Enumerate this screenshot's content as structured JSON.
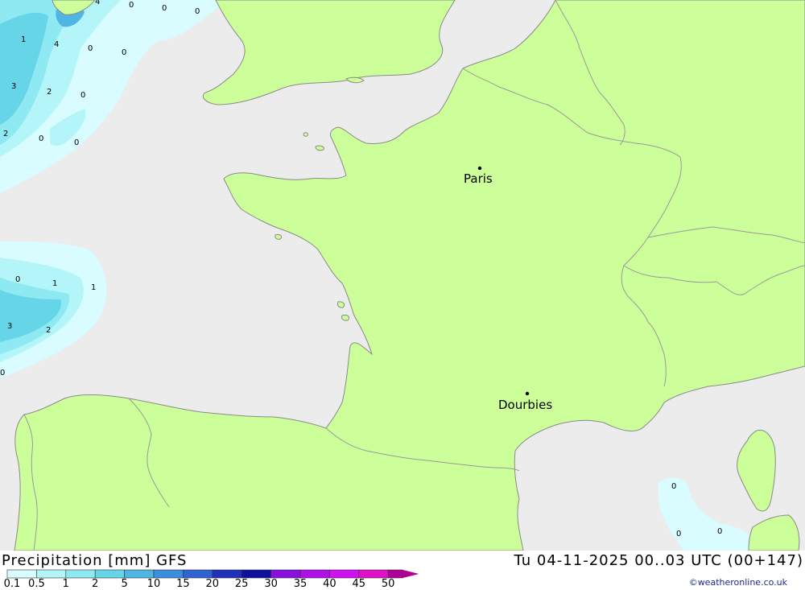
{
  "footer": {
    "title": "Precipitation [mm] GFS",
    "datetime": "Tu 04-11-2025 00..03 UTC (00+147)",
    "credit": "©weatheronline.co.uk"
  },
  "legend": {
    "labels": [
      "0.1",
      "0.5",
      "1",
      "2",
      "5",
      "10",
      "15",
      "20",
      "25",
      "30",
      "35",
      "40",
      "45",
      "50"
    ],
    "colors": [
      "#d8fcff",
      "#b4f5fa",
      "#8ee9f2",
      "#66d5e8",
      "#4fb6e3",
      "#3a8fdc",
      "#2e63d4",
      "#2030b8",
      "#1010a0",
      "#8a10e0",
      "#b010e8",
      "#d010f0",
      "#e010c8",
      "#b00098"
    ]
  },
  "map": {
    "colors": {
      "sea": "#ececec",
      "land": "#ccff99",
      "border": "#9a9a9a",
      "coast": "#8a8a8a"
    },
    "cities": [
      {
        "name": "Paris"
      },
      {
        "name": "Dourbies"
      }
    ],
    "values_west": [
      "4",
      "0",
      "0",
      "0",
      "1",
      "4",
      "0",
      "0",
      "3",
      "2",
      "0",
      "2",
      "0",
      "0",
      "0",
      "1",
      "1",
      "3",
      "2",
      "0"
    ],
    "values_med": [
      "0",
      "0",
      "0"
    ]
  }
}
